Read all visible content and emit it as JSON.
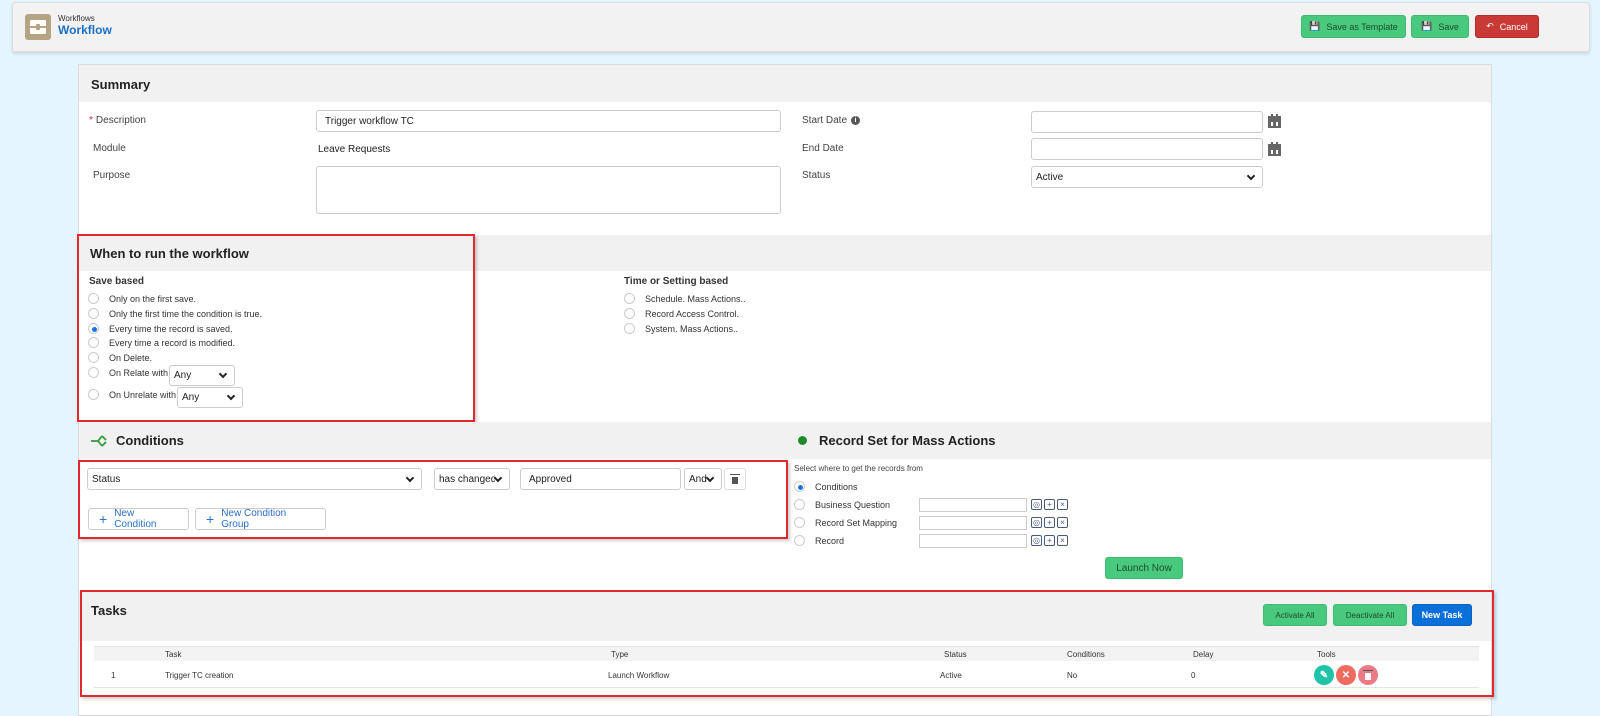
{
  "header": {
    "breadcrumb": "Workflows",
    "title": "Workflow",
    "buttons": {
      "save_template": "Save as Template",
      "save": "Save",
      "cancel": "Cancel"
    }
  },
  "summary": {
    "title": "Summary",
    "description_label": "Description",
    "required_mark": "*",
    "description_value": "Trigger workflow TC",
    "module_label": "Module",
    "module_value": "Leave Requests",
    "purpose_label": "Purpose",
    "purpose_value": "",
    "start_date_label": "Start Date",
    "start_date_value": "",
    "end_date_label": "End Date",
    "end_date_value": "",
    "status_label": "Status",
    "status_value": "Active"
  },
  "when": {
    "title": "When to run the workflow",
    "save_based_label": "Save based",
    "save_options": [
      {
        "label": "Only on the first save.",
        "selected": false
      },
      {
        "label": "Only the first time the condition is true.",
        "selected": false
      },
      {
        "label": "Every time the record is saved.",
        "selected": true
      },
      {
        "label": "Every time a record is modified.",
        "selected": false
      },
      {
        "label": "On Delete.",
        "selected": false
      },
      {
        "label": "On Relate with",
        "selected": false,
        "select_value": "Any"
      },
      {
        "label": "On Unrelate with",
        "selected": false,
        "select_value": "Any"
      }
    ],
    "time_based_label": "Time or Setting based",
    "time_options": [
      {
        "label": "Schedule. Mass Actions..",
        "selected": false
      },
      {
        "label": "Record Access Control.",
        "selected": false
      },
      {
        "label": "System. Mass Actions..",
        "selected": false
      }
    ]
  },
  "conditions": {
    "title": "Conditions",
    "field_value": "Status",
    "operator_value": "has changed",
    "value": "Approved",
    "logic_value": "And",
    "new_condition": "New Condition",
    "new_condition_group": "New Condition Group"
  },
  "record_set": {
    "title": "Record Set for Mass Actions",
    "prompt": "Select where to get the records from",
    "options": [
      {
        "label": "Conditions",
        "selected": true
      },
      {
        "label": "Business Question",
        "selected": false,
        "value": ""
      },
      {
        "label": "Record Set Mapping",
        "selected": false,
        "value": ""
      },
      {
        "label": "Record",
        "selected": false,
        "value": ""
      }
    ],
    "launch_now": "Launch Now"
  },
  "tasks": {
    "title": "Tasks",
    "activate_all": "Activate All",
    "deactivate_all": "Deactivate All",
    "new_task": "New Task",
    "columns": [
      "",
      "Task",
      "Type",
      "Status",
      "Conditions",
      "Delay",
      "Tools"
    ],
    "rows": [
      {
        "num": "1",
        "task": "Trigger TC creation",
        "type": "Launch Workflow",
        "status": "Active",
        "conditions": "No",
        "delay": "0"
      }
    ]
  },
  "colors": {
    "accent_green": "#48c97d",
    "danger_red": "#c93a36",
    "primary_blue": "#0a6fd8",
    "link_blue": "#1a6fc4",
    "highlight_red": "#e0282e"
  }
}
